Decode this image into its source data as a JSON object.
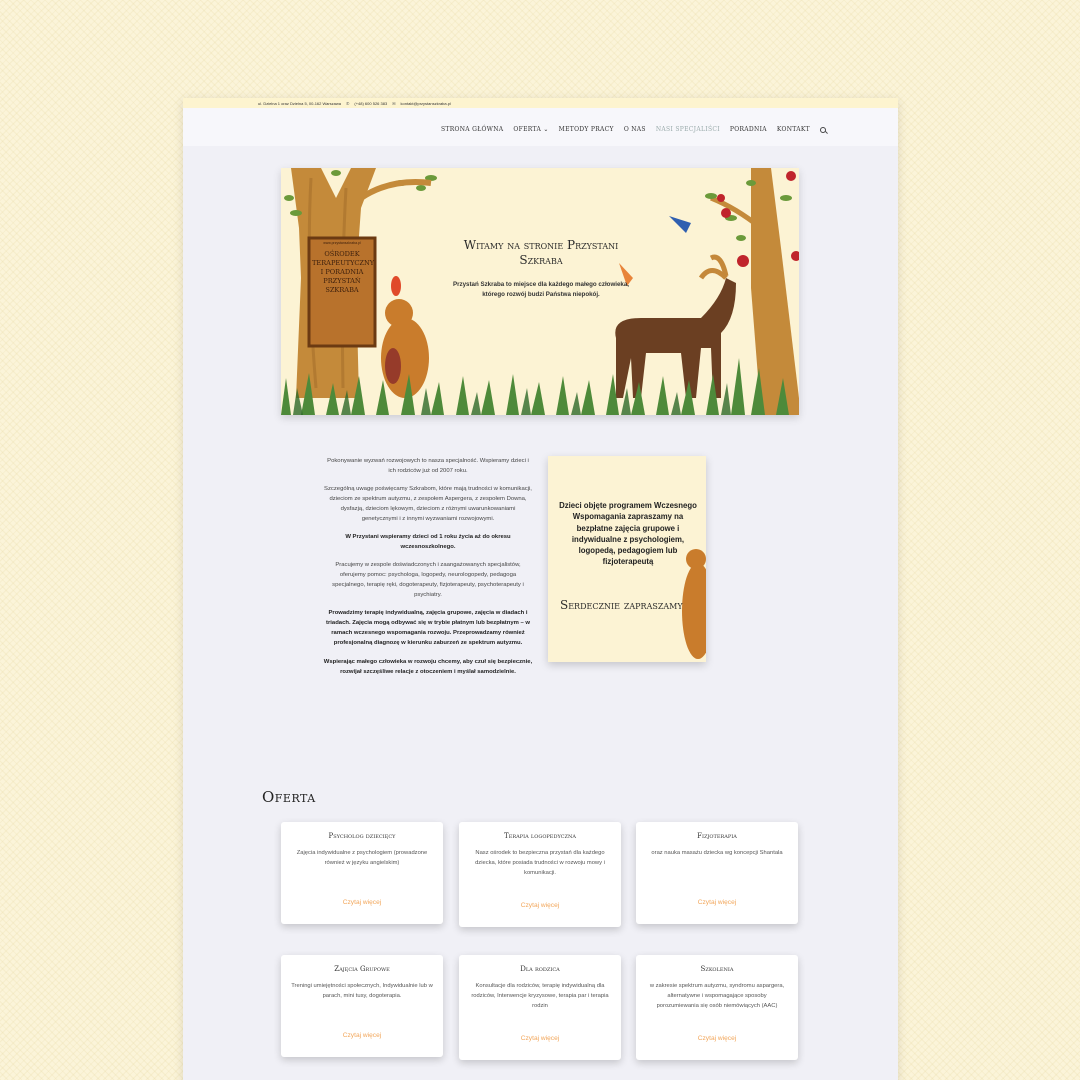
{
  "topbar": {
    "address": "ul. Dzielna 1 oraz Dzielna 5, 00-162 Warszawa",
    "phone": "(+48) 600 526 383",
    "email": "kontakt@przystanszkraba.pl"
  },
  "nav": {
    "items": [
      "Strona główna",
      "Oferta",
      "Metody pracy",
      "O nas",
      "Nasi specjaliści",
      "Poradnia",
      "Kontakt"
    ],
    "dropdown_caret": "⌄"
  },
  "hero": {
    "title": "Witamy na stronie Przystani Szkraba",
    "subtitle": "Przystań Szkraba to miejsce dla każdego małego człowieka, którego rozwój budzi Państwa niepokój.",
    "sign_url": "www.przystanszkraba.pl",
    "sign_text": "Ośrodek terapeutyczny i poradnia Przystań Szkraba"
  },
  "intro": {
    "paragraphs": [
      {
        "text": "Pokonywanie wyzwań rozwojowych to nasza specjalność. Wspieramy dzieci i ich rodziców już od 2007 roku.",
        "bold": false
      },
      {
        "text": "Szczególną uwagę poświęcamy Szkrabom, które mają trudności w komunikacji, dzieciom ze spektrum autyzmu, z zespołem Aspergera, z zespołem Downa, dysfazją, dzieciom lękowym, dzieciom z różnymi uwarunkowaniami genetycznymi i z innymi wyzwaniami rozwojowymi.",
        "bold": false
      },
      {
        "text": "W Przystani wspieramy dzieci od 1 roku życia aż do okresu wczesnoszkolnego.",
        "bold": true
      },
      {
        "text": "Pracujemy w zespole doświadczonych i zaangażowanych specjalistów, oferujemy pomoc: psychologa, logopedy, neurologopedy, pedagoga specjalnego, terapię ręki, dogoterapeuty, fizjoterapeuty, psychoterapeuty i psychiatry.",
        "bold": false
      },
      {
        "text": "Prowadzimy terapię indywidualną, zajęcia grupowe, zajęcia w diadach i triadach. Zajęcia mogą odbywać się w trybie płatnym lub bezpłatnym – w ramach wczesnego wspomagania rozwoju. Przeprowadzamy również profesjonalną diagnozę w kierunku zaburzeń ze spektrum autyzmu.",
        "bold": true
      },
      {
        "text": "Wspierając małego człowieka w rozwoju chcemy, aby czuł się bezpiecznie, rozwijał szczęśliwe relacje z otoczeniem i myślał samodzielnie.",
        "bold": true
      }
    ]
  },
  "promo": {
    "text": "Dzieci objęte programem Wczesnego Wspomagania zapraszamy na bezpłatne zajęcia grupowe i indywidualne z psychologiem, logopedą, pedagogiem lub fizjoterapeutą",
    "welcome": "Serdecznie zapraszamy"
  },
  "offer": {
    "title": "Oferta",
    "cards": [
      {
        "title": "Psycholog dziecięcy",
        "desc": "Zajęcia indywidualne z psychologiem (prowadzone również w języku angielskim)",
        "more": "Czytaj więcej"
      },
      {
        "title": "Terapia logopedyczna",
        "desc": "Nasz ośrodek to bezpieczna przystań dla każdego dziecka, które posiada trudności w rozwoju mowy i komunikacji.",
        "more": "Czytaj więcej"
      },
      {
        "title": "Fizjoterapia",
        "desc": "oraz nauka masażu dziecka wg koncepcji Shantala",
        "more": "Czytaj więcej"
      },
      {
        "title": "Zajęcia Grupowe",
        "desc": "Treningi umiejętności społecznych, Indywidualnie lub w parach, mini tusy, dogoterapia.",
        "more": "Czytaj więcej"
      },
      {
        "title": "Dla rodzica",
        "desc": "Konsultacje dla rodziców, terapię indywidualną dla rodziców, Interwencje kryzysowe, terapia par i terapia rodzin",
        "more": "Czytaj więcej"
      },
      {
        "title": "Szkolenia",
        "desc": "w zakresie spektrum autyzmu, syndromu aspargera, alternatywne i wspomagające sposoby porozumiewania się osób niemówiących (AAC)",
        "more": "Czytaj więcej"
      }
    ]
  }
}
